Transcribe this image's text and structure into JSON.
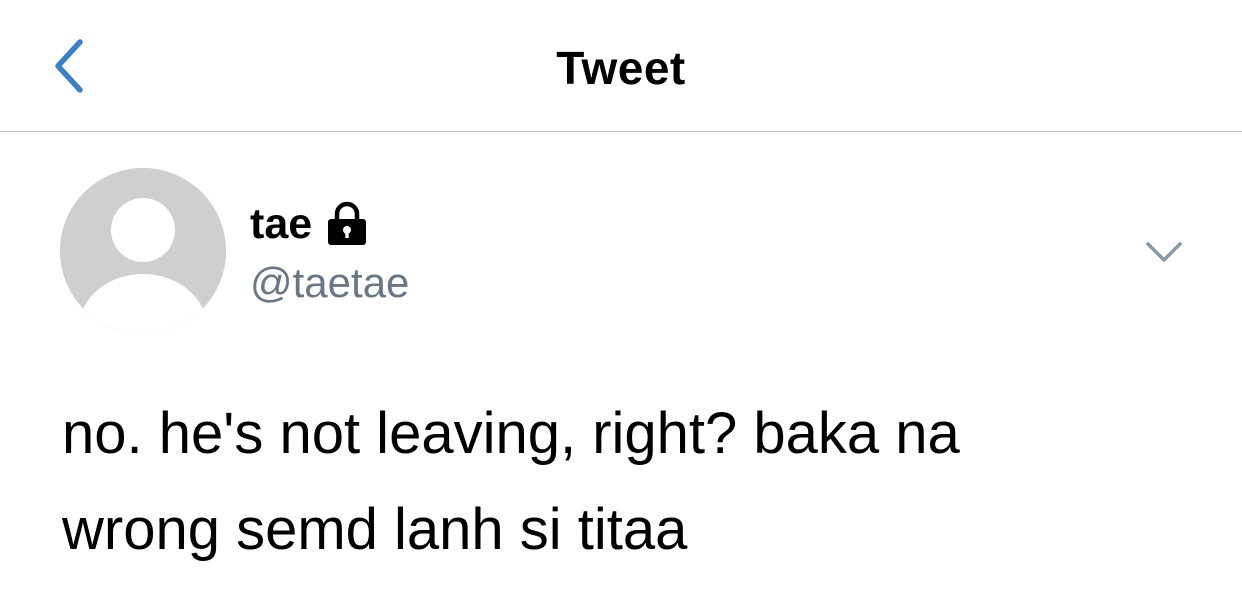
{
  "nav": {
    "title": "Tweet",
    "back_icon": "chevron-left-icon",
    "accent_color": "#3b7fc4"
  },
  "tweet": {
    "author": {
      "display_name": "tae",
      "handle": "@taetae",
      "protected_icon": "lock-icon",
      "avatar": "default-avatar-placeholder"
    },
    "menu_icon": "chevron-down-icon",
    "text": "no. he's not leaving, right? baka na\nwrong semd lanh si titaa"
  },
  "colors": {
    "background": "#ffffff",
    "text": "#000000",
    "handle": "#697785",
    "avatar_bg": "#cfcfcf",
    "avatar_figure": "#ffffff",
    "divider": "#bdbdbd"
  }
}
